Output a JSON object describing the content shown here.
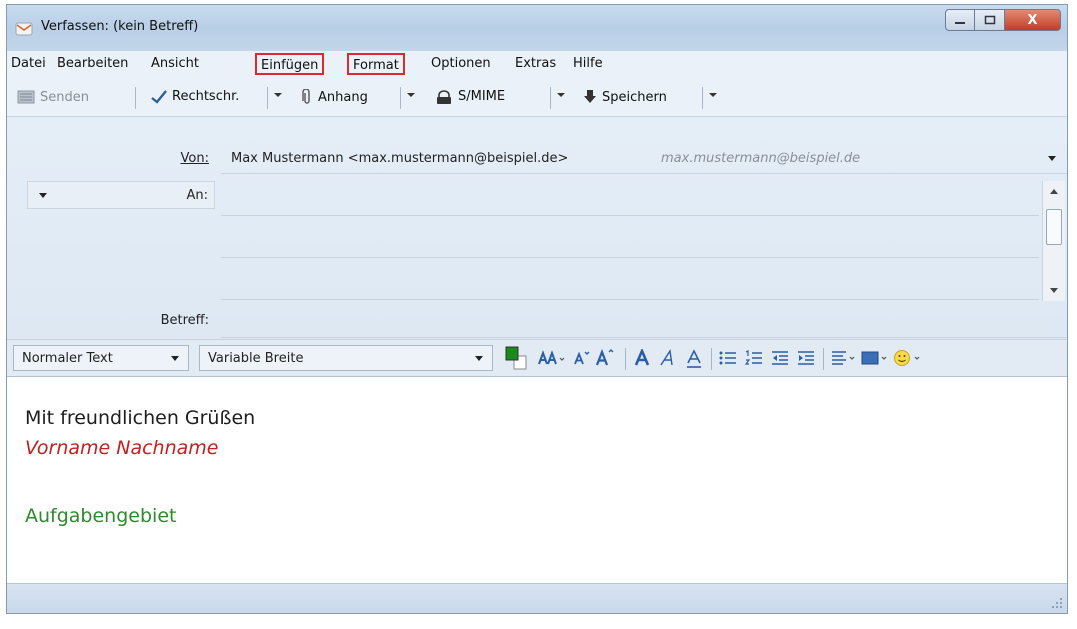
{
  "window": {
    "title": "Verfassen: (kein Betreff)",
    "close_glyph": "X"
  },
  "menu": {
    "items": [
      {
        "label": "Datei"
      },
      {
        "label": "Bearbeiten"
      },
      {
        "label": "Ansicht"
      },
      {
        "label": "Einfügen"
      },
      {
        "label": "Format"
      },
      {
        "label": "Optionen"
      },
      {
        "label": "Extras"
      },
      {
        "label": "Hilfe"
      }
    ]
  },
  "toolbar": {
    "send": "Senden",
    "spell": "Rechtschr.",
    "attach": "Anhang",
    "smime": "S/MIME",
    "save": "Speichern"
  },
  "headers": {
    "from_label": "Von:",
    "from_value": "Max Mustermann <max.mustermann@beispiel.de>",
    "from_identity": "max.mustermann@beispiel.de",
    "to_label": "An:",
    "subject_label": "Betreff:"
  },
  "format": {
    "paragraph": "Normaler Text",
    "font": "Variable Breite"
  },
  "body": {
    "line1": "Mit freundlichen Grüßen",
    "line2": "Vorname Nachname",
    "line3": "Aufgabengebiet"
  },
  "colors": {
    "highlight": "#dc2b2b",
    "name_color": "#c42020",
    "role_color": "#2f8a2f"
  }
}
